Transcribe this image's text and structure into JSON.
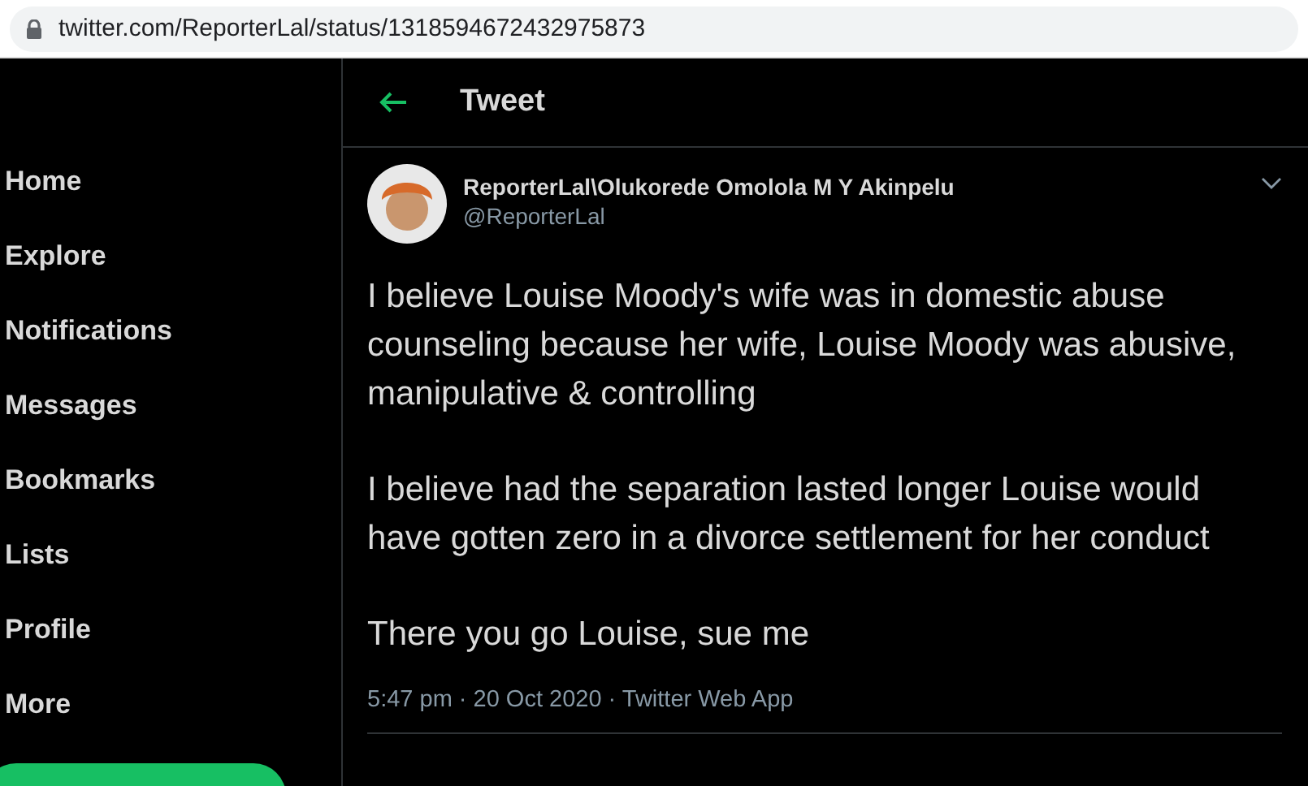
{
  "address_bar": {
    "url": "twitter.com/ReporterLal/status/1318594672432975873"
  },
  "sidebar": {
    "items": [
      {
        "label": "Home"
      },
      {
        "label": "Explore"
      },
      {
        "label": "Notifications"
      },
      {
        "label": "Messages"
      },
      {
        "label": "Bookmarks"
      },
      {
        "label": "Lists"
      },
      {
        "label": "Profile"
      },
      {
        "label": "More"
      }
    ]
  },
  "header": {
    "title": "Tweet"
  },
  "tweet": {
    "display_name": "ReporterLal\\Olukorede Omolola M Y Akinpelu",
    "handle": "@ReporterLal",
    "paragraphs": [
      "I believe Louise Moody's wife was in domestic abuse counseling because her wife, Louise Moody was abusive, manipulative & controlling",
      "I believe had the separation lasted longer Louise would have gotten zero in a divorce settlement for her conduct",
      "There you go Louise, sue me"
    ],
    "meta": "5:47 pm · 20 Oct 2020 · Twitter Web App"
  }
}
